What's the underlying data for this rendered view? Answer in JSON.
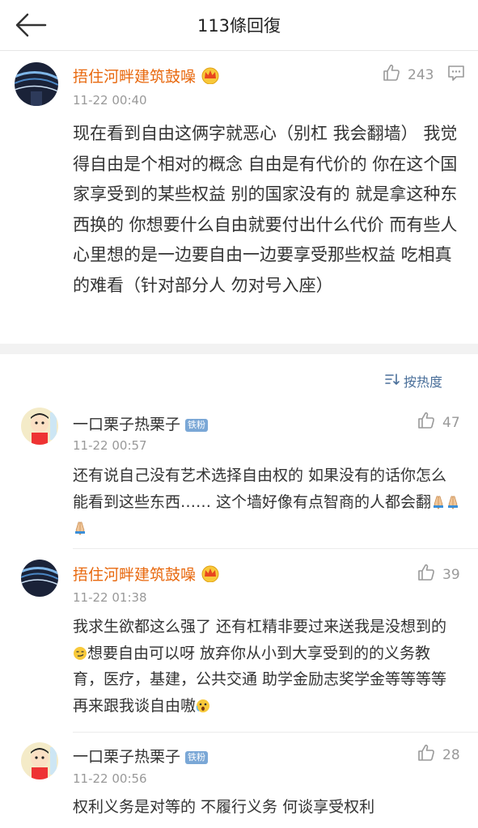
{
  "header": {
    "title": "113條回復"
  },
  "main_comment": {
    "username": "捂住河畔建筑鼓噪",
    "time": "11-22 00:40",
    "likes": "243",
    "text": "现在看到自由这俩字就恶心（别杠 我会翻墙） 我觉得自由是个相对的概念 自由是有代价的 你在这个国家享受到的某些权益 别的国家没有的 就是拿这种东西换的 你想要什么自由就要付出什么代价 而有些人心里想的是一边要自由一边要享受那些权益 吃相真的难看（针对部分人 勿对号入座）"
  },
  "sort": {
    "label": "按热度"
  },
  "replies": [
    {
      "username": "一口栗子热栗子",
      "badge": "铁粉",
      "time": "11-22 00:57",
      "likes": "47",
      "text": "还有说自己没有艺术选择自由权的 如果没有的话你怎么能看到这些东西…… 这个墙好像有点智商的人都会翻",
      "emoji": "pray-pray-pray"
    },
    {
      "username": "捂住河畔建筑鼓噪",
      "time": "11-22 01:38",
      "likes": "39",
      "text_a": "我求生欲都这么强了 还有杠精非要过来送我是没想到的",
      "text_b": "想要自由可以呀 放弃你从小到大享受到的的义务教育，医疗，基建，公共交通 助学金励志奖学金等等等等再来跟我谈自由嗷",
      "emoji_a": "smirk",
      "emoji_b": "scream"
    },
    {
      "username": "一口栗子热栗子",
      "badge": "铁粉",
      "time": "11-22 00:56",
      "likes": "28",
      "text": "权利义务是对等的 不履行义务 何谈享受权利"
    }
  ]
}
